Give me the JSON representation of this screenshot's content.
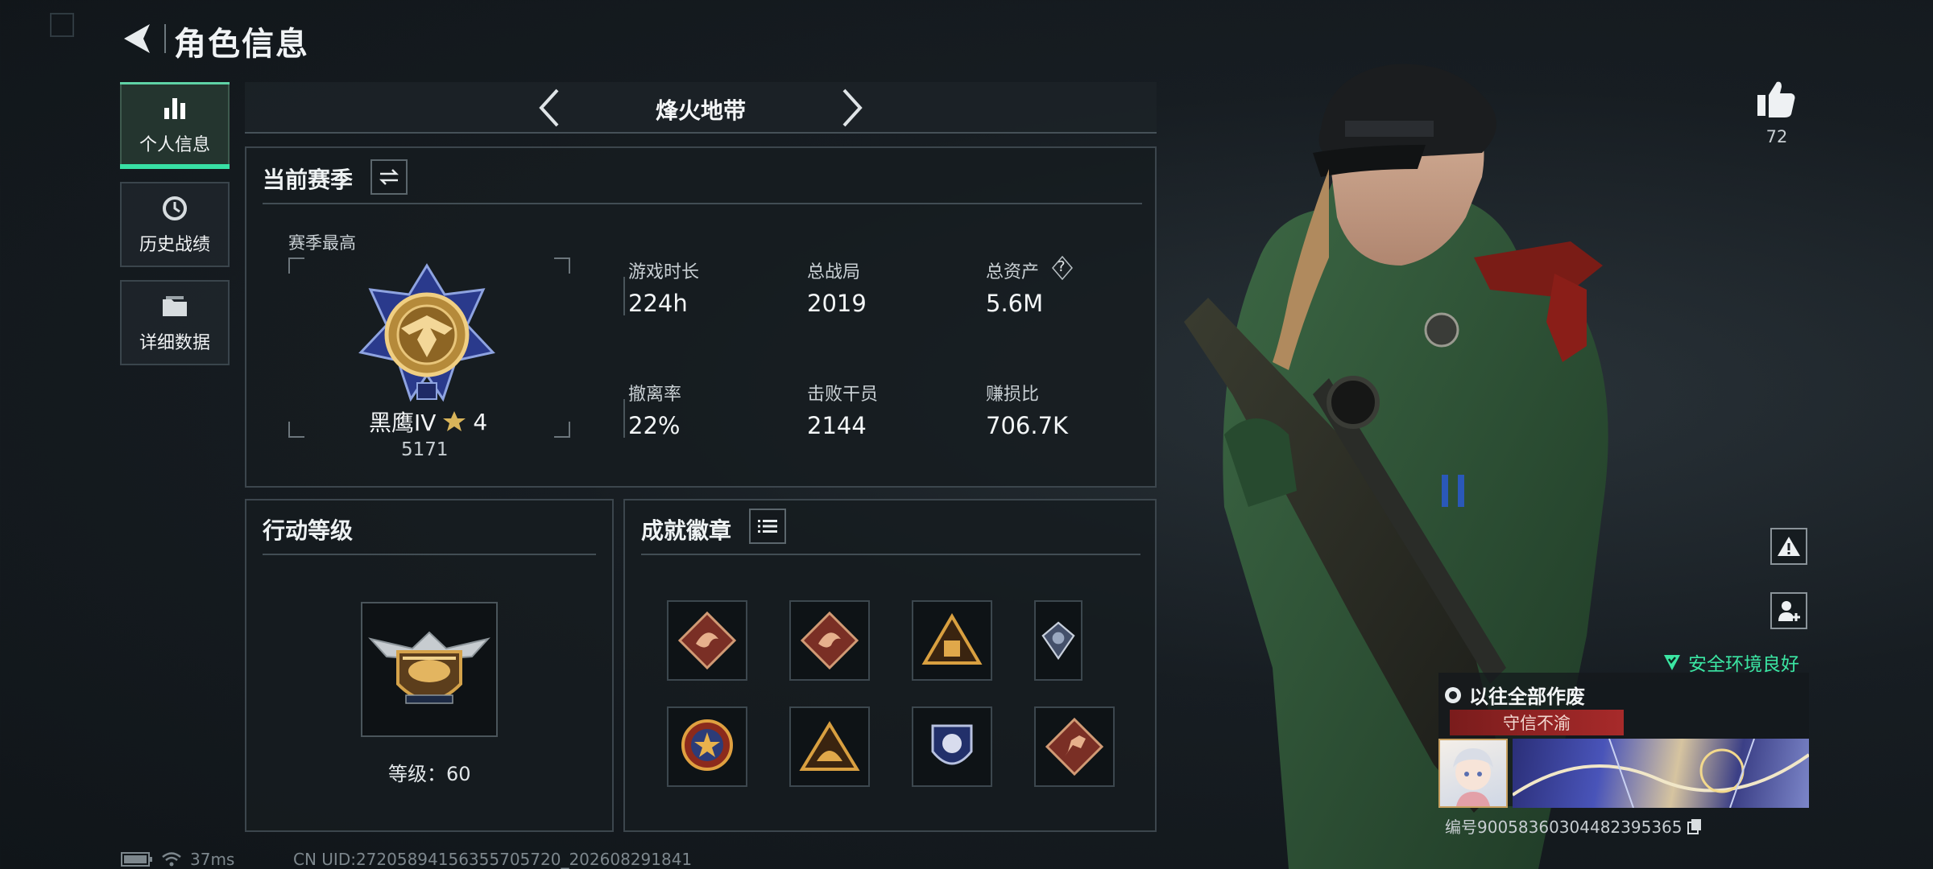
{
  "header": {
    "title": "角色信息"
  },
  "nav": [
    {
      "label": "个人信息",
      "icon": "bar-chart-icon",
      "active": true
    },
    {
      "label": "历史战绩",
      "icon": "history-clock-icon",
      "active": false
    },
    {
      "label": "详细数据",
      "icon": "folder-icon",
      "active": false
    }
  ],
  "mode": {
    "title": "烽火地带"
  },
  "season": {
    "title": "当前赛季",
    "best_label": "赛季最高",
    "rank_name": "黑鹰IV",
    "rank_stars": "4",
    "rank_score": "5171",
    "stats": [
      {
        "label": "游戏时长",
        "value": "224h"
      },
      {
        "label": "总战局",
        "value": "2019"
      },
      {
        "label": "总资产",
        "value": "5.6M"
      },
      {
        "label": "撤离率",
        "value": "22%"
      },
      {
        "label": "击败干员",
        "value": "2144"
      },
      {
        "label": "赚损比",
        "value": "706.7K"
      }
    ],
    "help_glyph": "?"
  },
  "action_level": {
    "title": "行动等级",
    "level_text": "等级：60"
  },
  "achievements": {
    "title": "成就徽章",
    "badges": [
      "dragon-badge",
      "dragon-badge",
      "pyramid-badge",
      "shield-badge",
      "star-medal-badge",
      "triangle-badge",
      "police-badge",
      "runner-badge"
    ]
  },
  "social": {
    "like_count": "72"
  },
  "player_card": {
    "safety": "安全环境良好",
    "name": "以往全部作废",
    "tag": "守信不渝",
    "id_text": "编号9005836030448239536​5"
  },
  "status": {
    "ping": "37ms",
    "uid": "CN UID:27205894156355705720_202608291841"
  },
  "colors": {
    "accent_green": "#38e0a4",
    "tag_red": "#a72a2a"
  }
}
